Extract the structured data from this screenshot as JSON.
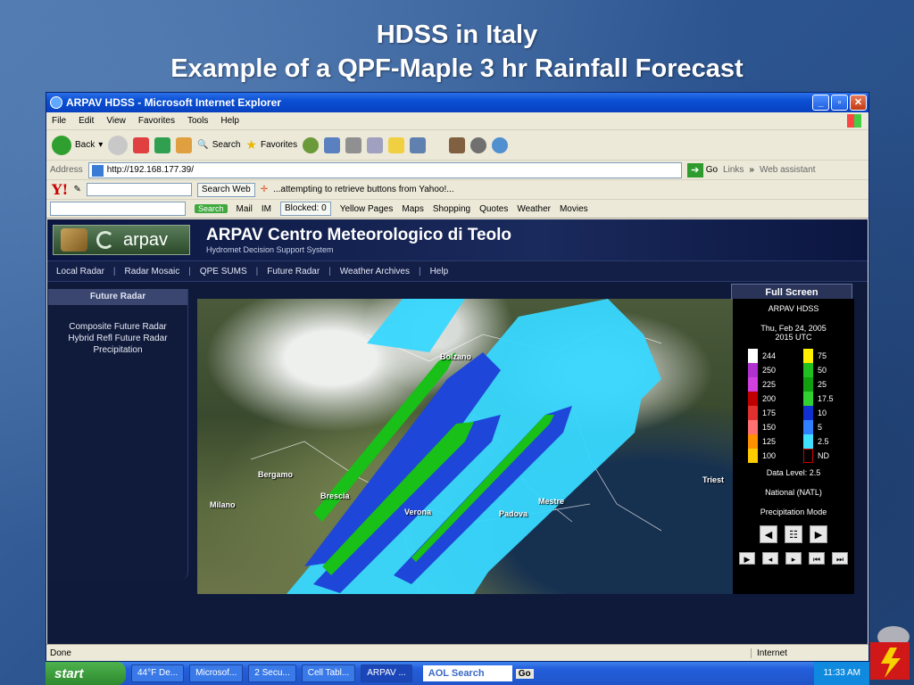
{
  "slide": {
    "title_line1": "HDSS in Italy",
    "title_line2": "Example of a QPF-Maple 3 hr Rainfall Forecast"
  },
  "window": {
    "title": "ARPAV HDSS - Microsoft Internet Explorer",
    "menu": [
      "File",
      "Edit",
      "View",
      "Favorites",
      "Tools",
      "Help"
    ],
    "toolbar": {
      "back": "Back",
      "search": "Search",
      "favorites": "Favorites"
    },
    "address": {
      "label": "Address",
      "url": "http://192.168.177.39/",
      "go": "Go",
      "links": "Links",
      "web_assistant": "Web assistant"
    },
    "yahoo": {
      "logo": "Y!",
      "search_web": "Search Web",
      "status": "...attempting to retrieve buttons from Yahoo!..."
    },
    "aol": {
      "search_btn": "Search",
      "mail": "Mail",
      "im": "IM",
      "blocked": "Blocked: 0",
      "yellow_pages": "Yellow Pages",
      "maps": "Maps",
      "shopping": "Shopping",
      "quotes": "Quotes",
      "weather": "Weather",
      "movies": "Movies"
    },
    "statusbar": {
      "done": "Done",
      "zone": "Internet"
    }
  },
  "page": {
    "logo_text": "arpav",
    "banner_title": "ARPAV Centro Meteorologico di Teolo",
    "banner_sub": "Hydromet Decision Support System",
    "nav": [
      "Local Radar",
      "Radar Mosaic",
      "QPE SUMS",
      "Future Radar",
      "Weather Archives",
      "Help"
    ],
    "sidebar": {
      "heading": "Future Radar",
      "items": [
        "Composite Future Radar",
        "Hybrid Refl Future Radar",
        "Precipitation"
      ]
    },
    "full_screen": "Full Screen",
    "map_labels": {
      "bolzano": "Bolzano",
      "bergamo": "Bergamo",
      "milano": "Milano",
      "brescia": "Brescia",
      "verona": "Verona",
      "padova": "Padova",
      "mestre": "Mestre",
      "trieste": "Triest"
    },
    "panel": {
      "title": "ARPAV HDSS",
      "date": "Thu, Feb 24, 2005",
      "time": "2015 UTC",
      "data_level": "Data Level:  2.5",
      "national": "National (NATL)",
      "mode": "Precipitation Mode",
      "legend_left": [
        {
          "label": "244",
          "color": "#ffffff"
        },
        {
          "label": "250",
          "color": "#b030d0"
        },
        {
          "label": "225",
          "color": "#d040e0"
        },
        {
          "label": "200",
          "color": "#c00000"
        },
        {
          "label": "175",
          "color": "#e03030"
        },
        {
          "label": "150",
          "color": "#ff7070"
        },
        {
          "label": "125",
          "color": "#ff9000"
        },
        {
          "label": "100",
          "color": "#ffcc00"
        }
      ],
      "legend_right": [
        {
          "label": "75",
          "color": "#ffee00"
        },
        {
          "label": "50",
          "color": "#20c020"
        },
        {
          "label": "25",
          "color": "#10a010"
        },
        {
          "label": "17.5",
          "color": "#30d030"
        },
        {
          "label": "10",
          "color": "#1030d0"
        },
        {
          "label": "5",
          "color": "#3080ff"
        },
        {
          "label": "2.5",
          "color": "#40e0ff"
        },
        {
          "label": "ND",
          "color": "#000000"
        }
      ]
    }
  },
  "taskbar": {
    "start": "start",
    "items": [
      "44°F De...",
      "Microsof...",
      "2 Secu...",
      "Cell Tabl...",
      "ARPAV ..."
    ],
    "search": "AOL Search",
    "go": "Go",
    "clock": "11:33 AM"
  }
}
